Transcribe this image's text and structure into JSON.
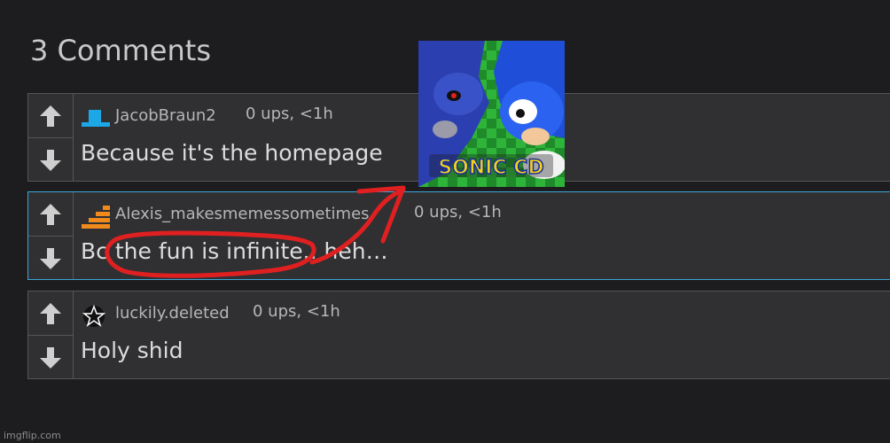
{
  "header": {
    "title": "3 Comments"
  },
  "comments": [
    {
      "user": "JacobBraun2",
      "meta": "0 ups, <1h",
      "text": "Because it's the homepage",
      "avatar": "blue-platform-icon"
    },
    {
      "user": "Alexis_makesmemessometimes",
      "meta": "0 ups, <1h",
      "text": "Bc the fun is infinite.. heh…",
      "avatar": "orange-stairs-icon"
    },
    {
      "user": "luckily.deleted",
      "meta": "0 ups, <1h",
      "text": "Holy shid",
      "avatar": "star-outline-icon"
    }
  ],
  "image": {
    "caption": "SONIC CD"
  },
  "watermark": "imgflip.com",
  "colors": {
    "background": "#1d1d1f",
    "card": "#303033",
    "active_border": "#3aa6d8",
    "annotation": "#e02020"
  }
}
